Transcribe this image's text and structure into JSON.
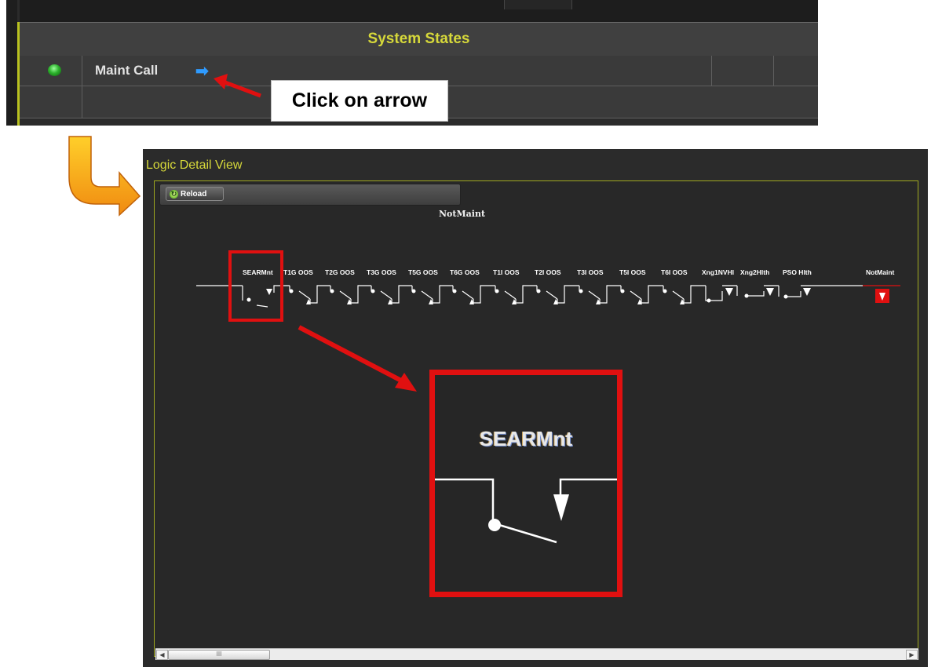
{
  "system_states": {
    "title": "System States",
    "rows": [
      {
        "label": "Maint Call",
        "status_color": "#2db22d",
        "arrow_icon": "right-arrow-icon",
        "arrow_glyph": "➡"
      }
    ]
  },
  "callout": {
    "text": "Click on arrow"
  },
  "logic_view": {
    "title": "Logic Detail View",
    "reload_label": "Reload",
    "diagram_title": "NotMaint",
    "contacts": [
      "SEARMnt",
      "T1G OOS",
      "T2G OOS",
      "T3G OOS",
      "T5G OOS",
      "T6G OOS",
      "T1I OOS",
      "T2I OOS",
      "T3I OOS",
      "T5I OOS",
      "T6I OOS",
      "Xng1NVHl",
      "Xng2Hlth",
      "PSO Hlth"
    ],
    "output_coil": "NotMaint",
    "zoom_label": "SEARMnt",
    "scroll_thumb_glyph": "III"
  },
  "colors": {
    "accent": "#d6d83a",
    "highlight": "#e01010",
    "frame": "#9fa81f",
    "link": "#2f9bff"
  }
}
